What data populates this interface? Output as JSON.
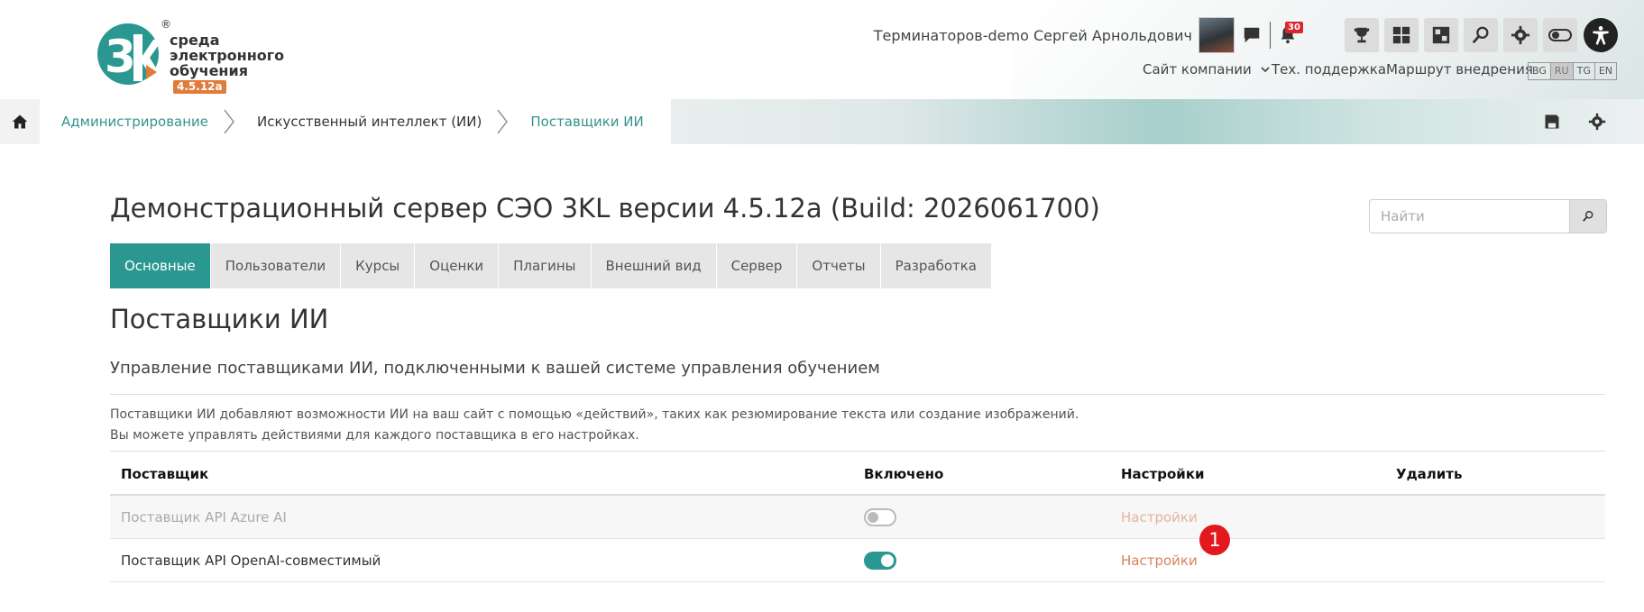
{
  "brand": {
    "logo_line1": "среда",
    "logo_line2": "электронного",
    "logo_line3": "обучения",
    "version": "4.5.12a",
    "registered": "®",
    "colors": {
      "teal": "#2a9890",
      "orange": "#e07b39"
    }
  },
  "header": {
    "user_name": "Терминаторов-demo Сергей Арнольдович",
    "notifications_count": "30",
    "toolbar_icons": [
      "trophy-icon",
      "dashboard-icon",
      "puzzle-icon",
      "search-icon",
      "gear-icon",
      "toggle-icon",
      "accessibility-icon"
    ],
    "nav": {
      "company_site": "Сайт компании",
      "support": "Тех. поддержка",
      "route": "Маршрут внедрения"
    },
    "languages": [
      "BG",
      "RU",
      "TG",
      "EN"
    ],
    "active_language": "RU"
  },
  "breadcrumb": {
    "items": [
      "Администрирование",
      "Искусственный интеллект (ИИ)",
      "Поставщики ИИ"
    ]
  },
  "page": {
    "heading": "Демонстрационный сервер СЭО 3KL версии 4.5.12a (Build: 2026061700)",
    "search_placeholder": "Найти",
    "tabs": [
      "Основные",
      "Пользователи",
      "Курсы",
      "Оценки",
      "Плагины",
      "Внешний вид",
      "Сервер",
      "Отчеты",
      "Разработка"
    ],
    "active_tab": "Основные",
    "section_title": "Поставщики ИИ",
    "subtitle": "Управление поставщиками ИИ, подключенными к вашей системе управления обучением",
    "description_line1": "Поставщики ИИ добавляют возможности ИИ на ваш сайт с помощью «действий», таких как резюмирование текста или создание изображений.",
    "description_line2": "Вы можете управлять действиями для каждого поставщика в его настройках."
  },
  "table": {
    "headers": {
      "provider": "Поставщик",
      "enabled": "Включено",
      "settings": "Настройки",
      "delete": "Удалить"
    },
    "rows": [
      {
        "name": "Поставщик API Azure AI",
        "enabled": false,
        "settings": "Настройки"
      },
      {
        "name": "Поставщик API OpenAI-совместимый",
        "enabled": true,
        "settings": "Настройки"
      }
    ]
  },
  "marker": "1"
}
